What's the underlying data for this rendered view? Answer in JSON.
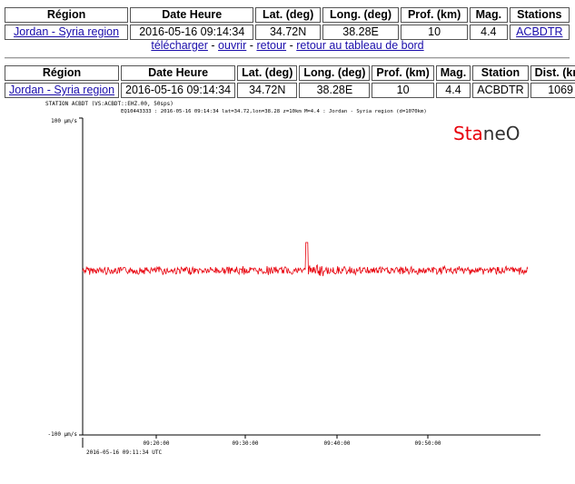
{
  "table1": {
    "headers": [
      "Région",
      "Date Heure",
      "Lat. (deg)",
      "Long. (deg)",
      "Prof. (km)",
      "Mag.",
      "Stations"
    ],
    "row": {
      "region": "Jordan - Syria region",
      "datetime": "2016-05-16 09:14:34",
      "lat": "34.72N",
      "lon": "38.28E",
      "depth": "10",
      "mag": "4.4",
      "stations": "ACBDTR"
    }
  },
  "links": {
    "download": "télécharger",
    "open": "ouvrir",
    "back": "retour",
    "dashboard": "retour au tableau de bord",
    "separator": "-"
  },
  "table2": {
    "headers": [
      "Région",
      "Date Heure",
      "Lat. (deg)",
      "Long. (deg)",
      "Prof. (km)",
      "Mag.",
      "Station",
      "Dist. (km)"
    ],
    "row": {
      "region": "Jordan - Syria region",
      "datetime": "2016-05-16 09:14:34",
      "lat": "34.72N",
      "lon": "38.28E",
      "depth": "10",
      "mag": "4.4",
      "station": "ACBDTR",
      "dist": "1069"
    }
  },
  "seismogram": {
    "station_header": "STATION ACBDT (VS:ACBDT::EHZ.00, 50sps)",
    "event_header": "EQ10443333 : 2016-05-16 09:14:34 lat=34.72,lon=38.28 z=10km M=4.4 : Jordan - Syria region (d=1070km)",
    "logo": "StaneO",
    "y_top_label": "100 µm/s",
    "y_bottom_label": "-100 µm/s",
    "x_ticks": [
      "09:20:00",
      "09:30:00",
      "09:40:00",
      "09:50:00"
    ],
    "start_label": "2016-05-16 09:11:34 UTC",
    "trace_color": "#e8000b",
    "logo_color_sta": "#e8000b",
    "logo_color_neo": "#333333"
  }
}
